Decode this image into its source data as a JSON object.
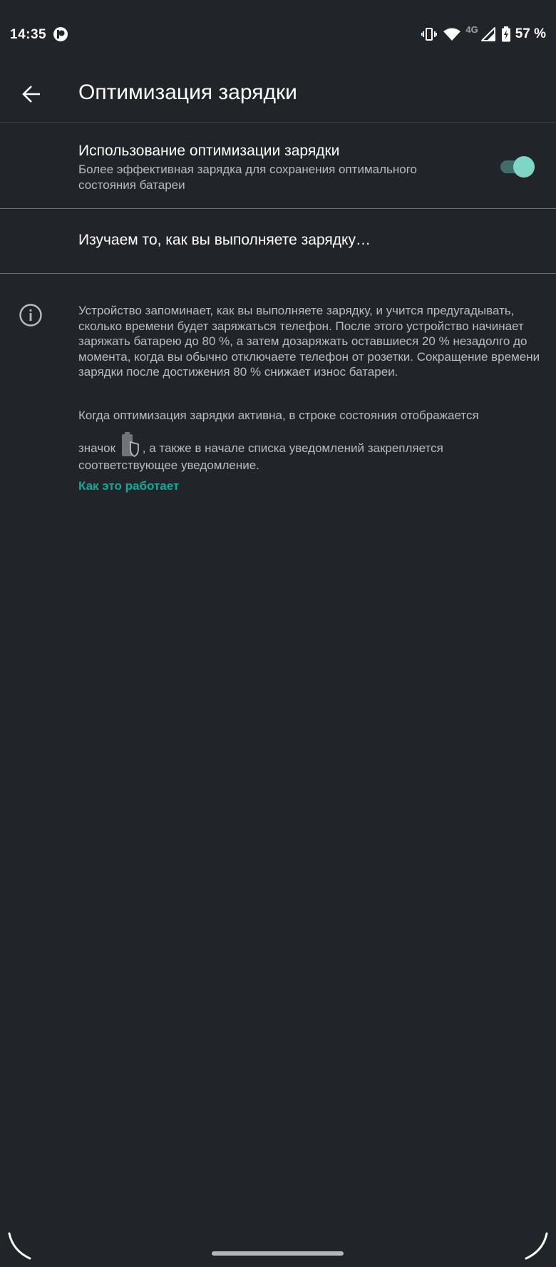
{
  "status_bar": {
    "time": "14:35",
    "network_type": "4G",
    "battery_percent": "57 %",
    "icons": [
      "app-notification-icon",
      "vibrate-icon",
      "wifi-icon",
      "cell-signal-icon",
      "battery-charging-icon"
    ]
  },
  "app_bar": {
    "title": "Оптимизация зарядки",
    "back_icon": "arrow-back-icon"
  },
  "setting": {
    "title": "Использование оптимизации зарядки",
    "summary": "Более эффективная зарядка для сохранения оптимального состояния батареи",
    "enabled": true
  },
  "learning_text": "Изучаем то, как вы выполняете зарядку…",
  "info": {
    "icon": "info-icon",
    "paragraph1": "Устройство запоминает, как вы выполняете зарядку, и учится предугадывать, сколько времени будет заряжаться телефон. После этого устройство начинает заряжать батарею до 80 %, а затем дозаряжать оставшиеся 20 % незадолго до момента, когда вы обычно отключаете телефон от розетки. Сокращение времени зарядки после достижения 80 % снижает износ батареи.",
    "paragraph2_line1": "Когда оптимизация зарядки активна, в строке состояния отображается",
    "paragraph2_before_icon": "значок",
    "paragraph2_after_icon": ", а также в начале списка уведомлений закрепляется соответствующее уведомление.",
    "link": "Как это работает"
  },
  "colors": {
    "background": "#212529",
    "accent": "#13a99a",
    "switch_thumb": "#7fd6c6",
    "switch_track": "#3f6e69"
  }
}
